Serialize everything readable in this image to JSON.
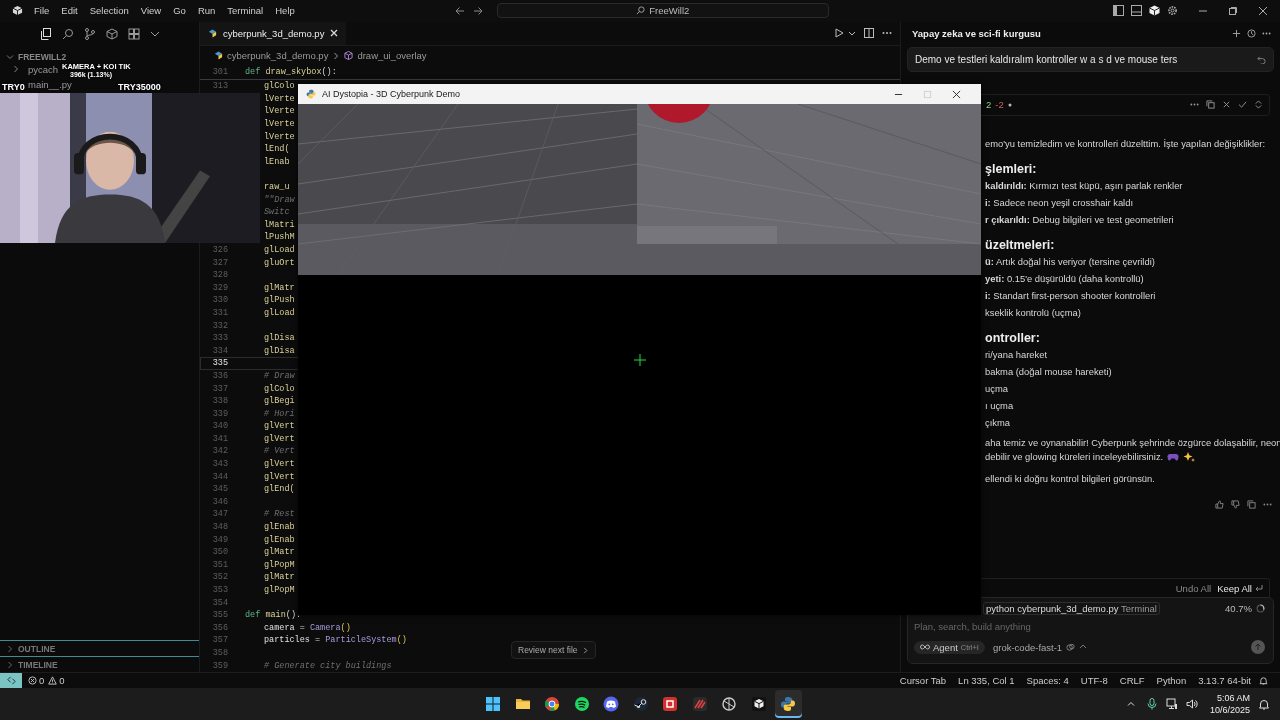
{
  "titlebar": {
    "menus": [
      "File",
      "Edit",
      "Selection",
      "View",
      "Go",
      "Run",
      "Terminal",
      "Help"
    ],
    "search": "FreeWill2"
  },
  "sidebar": {
    "section": "FREEWILL2",
    "items": [
      {
        "label": "pycach",
        "kind": "folder"
      },
      {
        "label": "main__.py",
        "kind": "file"
      }
    ],
    "panels": [
      "OUTLINE",
      "TIMELINE"
    ]
  },
  "editor": {
    "tab": "cyberpunk_3d_demo.py",
    "breadcrumbs": [
      "cyberpunk_3d_demo.py",
      "draw_ui_overlay"
    ],
    "sticky": {
      "number": "301",
      "parts": [
        {
          "text": "def ",
          "kind": "kw"
        },
        {
          "text": "draw_skybox",
          "kind": "fn"
        },
        {
          "text": "():",
          "kind": "p"
        }
      ]
    },
    "lines": [
      {
        "number": "313",
        "current": false,
        "kind": "body",
        "parts": [
          {
            "text": "glColo",
            "kind": "fn"
          }
        ]
      },
      {
        "current": false,
        "kind": "body",
        "parts": [
          {
            "text": "lVerte",
            "kind": "fn"
          }
        ]
      },
      {
        "current": false,
        "kind": "body",
        "parts": [
          {
            "text": "lVerte",
            "kind": "fn"
          }
        ]
      },
      {
        "current": false,
        "kind": "body",
        "parts": [
          {
            "text": "lVerte",
            "kind": "fn"
          }
        ]
      },
      {
        "current": false,
        "kind": "body",
        "parts": [
          {
            "text": "lVerte",
            "kind": "fn"
          }
        ]
      },
      {
        "current": false,
        "kind": "body",
        "parts": [
          {
            "text": "lEnd(",
            "kind": "fn"
          }
        ]
      },
      {
        "current": false,
        "kind": "body",
        "parts": [
          {
            "text": "lEnab",
            "kind": "fn"
          }
        ]
      },
      {
        "current": false,
        "kind": "blank"
      },
      {
        "current": false,
        "kind": "body",
        "parts": [
          {
            "text": "raw_u",
            "kind": "fn"
          }
        ]
      },
      {
        "current": false,
        "kind": "body",
        "parts": [
          {
            "text": "\"\"Draw",
            "kind": "doc"
          }
        ]
      },
      {
        "current": false,
        "kind": "body",
        "parts": [
          {
            "text": "Switc",
            "kind": "doc"
          }
        ]
      },
      {
        "current": false,
        "kind": "body",
        "parts": [
          {
            "text": "lMatri",
            "kind": "fn"
          }
        ]
      },
      {
        "current": false,
        "kind": "body",
        "parts": [
          {
            "text": "lPushM",
            "kind": "fn"
          }
        ]
      },
      {
        "number": "326",
        "current": false,
        "kind": "body",
        "parts": [
          {
            "text": "glLoad",
            "kind": "fn"
          }
        ]
      },
      {
        "number": "327",
        "current": false,
        "kind": "body",
        "parts": [
          {
            "text": "gluOrt",
            "kind": "fn"
          }
        ]
      },
      {
        "number": "328",
        "current": false,
        "kind": "blank"
      },
      {
        "number": "329",
        "current": false,
        "kind": "body",
        "parts": [
          {
            "text": "glMatr",
            "kind": "fn"
          }
        ]
      },
      {
        "number": "330",
        "current": false,
        "kind": "body",
        "parts": [
          {
            "text": "glPush",
            "kind": "fn"
          }
        ]
      },
      {
        "number": "331",
        "current": false,
        "kind": "body",
        "parts": [
          {
            "text": "glLoad",
            "kind": "fn"
          }
        ]
      },
      {
        "number": "332",
        "current": false,
        "kind": "blank"
      },
      {
        "number": "333",
        "current": false,
        "kind": "body",
        "parts": [
          {
            "text": "glDisa",
            "kind": "fn"
          }
        ]
      },
      {
        "number": "334",
        "current": false,
        "kind": "body",
        "parts": [
          {
            "text": "glDisa",
            "kind": "fn"
          }
        ]
      },
      {
        "number": "335",
        "current": true,
        "kind": "blank"
      },
      {
        "number": "336",
        "current": false,
        "kind": "body",
        "parts": [
          {
            "text": "# Draw",
            "kind": "cm"
          }
        ]
      },
      {
        "number": "337",
        "current": false,
        "kind": "body",
        "parts": [
          {
            "text": "glColo",
            "kind": "fn"
          }
        ]
      },
      {
        "number": "338",
        "current": false,
        "kind": "body",
        "parts": [
          {
            "text": "glBegi",
            "kind": "fn"
          }
        ]
      },
      {
        "number": "339",
        "current": false,
        "kind": "body",
        "parts": [
          {
            "text": "# Hori",
            "kind": "cm"
          }
        ]
      },
      {
        "number": "340",
        "current": false,
        "kind": "body",
        "parts": [
          {
            "text": "glVert",
            "kind": "fn"
          }
        ]
      },
      {
        "number": "341",
        "current": false,
        "kind": "body",
        "parts": [
          {
            "text": "glVert",
            "kind": "fn"
          }
        ]
      },
      {
        "number": "342",
        "current": false,
        "kind": "body",
        "parts": [
          {
            "text": "# Vert",
            "kind": "cm"
          }
        ]
      },
      {
        "number": "343",
        "current": false,
        "kind": "body",
        "parts": [
          {
            "text": "glVert",
            "kind": "fn"
          }
        ]
      },
      {
        "number": "344",
        "current": false,
        "kind": "body",
        "parts": [
          {
            "text": "glVert",
            "kind": "fn"
          }
        ]
      },
      {
        "number": "345",
        "current": false,
        "kind": "body",
        "parts": [
          {
            "text": "glEnd(",
            "kind": "fn"
          }
        ]
      },
      {
        "number": "346",
        "current": false,
        "kind": "blank"
      },
      {
        "number": "347",
        "current": false,
        "kind": "body",
        "parts": [
          {
            "text": "# Rest",
            "kind": "cm"
          }
        ]
      },
      {
        "number": "348",
        "current": false,
        "kind": "body",
        "parts": [
          {
            "text": "glEnab",
            "kind": "fn"
          }
        ]
      },
      {
        "number": "349",
        "current": false,
        "kind": "body",
        "parts": [
          {
            "text": "glEnab",
            "kind": "fn"
          }
        ]
      },
      {
        "number": "350",
        "current": false,
        "kind": "body",
        "parts": [
          {
            "text": "glMatr",
            "kind": "fn"
          }
        ]
      },
      {
        "number": "351",
        "current": false,
        "kind": "body",
        "parts": [
          {
            "text": "glPopM",
            "kind": "fn"
          }
        ]
      },
      {
        "number": "352",
        "current": false,
        "kind": "body",
        "parts": [
          {
            "text": "glMatr",
            "kind": "fn"
          }
        ]
      },
      {
        "number": "353",
        "current": false,
        "kind": "body",
        "parts": [
          {
            "text": "glPopM",
            "kind": "fn"
          }
        ]
      },
      {
        "number": "354",
        "current": false,
        "kind": "blank"
      },
      {
        "number": "355",
        "current": false,
        "kind": "def",
        "parts": [
          {
            "text": "def ",
            "kind": "kw"
          },
          {
            "text": "main",
            "kind": "fn"
          },
          {
            "text": "():",
            "kind": "p"
          }
        ]
      },
      {
        "number": "356",
        "current": false,
        "kind": "body",
        "parts": [
          {
            "text": "camera",
            "kind": "var"
          },
          {
            "text": " = ",
            "kind": "p"
          },
          {
            "text": "Camera",
            "kind": "cls"
          },
          {
            "text": "()",
            "kind": "br"
          }
        ]
      },
      {
        "number": "357",
        "current": false,
        "kind": "body",
        "parts": [
          {
            "text": "particles",
            "kind": "var"
          },
          {
            "text": " = ",
            "kind": "p"
          },
          {
            "text": "ParticleSystem",
            "kind": "cls"
          },
          {
            "text": "()",
            "kind": "br"
          }
        ]
      },
      {
        "number": "358",
        "current": false,
        "kind": "blank"
      },
      {
        "number": "359",
        "current": false,
        "kind": "body",
        "parts": [
          {
            "text": "# Generate city buildings",
            "kind": "cm"
          }
        ]
      }
    ],
    "review_button": "Review next file"
  },
  "game_window": {
    "title": "AI Dystopia - 3D Cyberpunk Demo",
    "maximize_disabled": true
  },
  "stream_overlay": {
    "title": "KAMERA + KOI TIK",
    "stat": "396k (1.13%)",
    "left": "TRY0",
    "right": "TRY35000"
  },
  "chat": {
    "title": "Yapay zeka ve sci-fi kurgusu",
    "user_message": "Demo ve testleri kaldıralım kontroller w a s d ve mouse ters",
    "diff": {
      "added": "2",
      "removed": "-2"
    },
    "blocks": [
      {
        "kind": "text",
        "text": "emo'yu temizledim ve kontrolleri düzelttim. İşte yapılan değişiklikler:"
      },
      {
        "kind": "heading",
        "text": "şlemleri:"
      },
      {
        "kind": "item",
        "text": "**kaldırıldı:** Kırmızı test küpü, aşırı parlak renkler"
      },
      {
        "kind": "item",
        "text": "**i:** Sadece neon yeşil crosshair kaldı"
      },
      {
        "kind": "item",
        "text": "**r çıkarıldı:** Debug bilgileri ve test geometrileri"
      },
      {
        "kind": "heading",
        "text": "üzeltmeleri:"
      },
      {
        "kind": "item",
        "text": "**ü:** Artık doğal his veriyor (tersine çevrildi)"
      },
      {
        "kind": "item",
        "text": "**yeti:** 0.15'e düşürüldü (daha kontrollü)"
      },
      {
        "kind": "item",
        "text": "**i:** Standart first-person shooter kontrolleri"
      },
      {
        "kind": "item",
        "text": "kseklik kontrolü (uçma)"
      },
      {
        "kind": "heading",
        "text": "ontroller:"
      },
      {
        "kind": "item",
        "text": "ri/yana hareket"
      },
      {
        "kind": "item",
        "text": "bakma (doğal mouse hareketi)"
      },
      {
        "kind": "item",
        "text": "uçma"
      },
      {
        "kind": "item",
        "text": "ı uçma"
      },
      {
        "kind": "item",
        "text": "çıkma"
      },
      {
        "kind": "para",
        "text": "aha temiz ve oynanabilir! Cyberpunk şehrinde özgürce dolaşabilir, neon"
      },
      {
        "kind": "emoji-line",
        "text": "debilir ve glowing küreleri inceleyebilirsiniz."
      },
      {
        "kind": "para",
        "text": "ellendi ki doğru kontrol bilgileri görünsün."
      }
    ],
    "undo": "Undo All",
    "keep": "Keep All",
    "terminal": {
      "command": "python cyberpunk_3d_demo.py",
      "label": "Terminal"
    },
    "context": "40.7%",
    "placeholder": "Plan, search, build anything",
    "mode": "Agent",
    "shortcut": "Ctrl+I",
    "model": "grok-code-fast-1"
  },
  "status_bar": {
    "errors": "0",
    "warnings": "0",
    "items": [
      "Cursor Tab",
      "Ln 335, Col 1",
      "Spaces: 4",
      "UTF-8",
      "CRLF",
      "Python",
      "3.13.7 64-bit"
    ]
  },
  "taskbar": {
    "apps": [
      {
        "kind": "start",
        "active": false
      },
      {
        "kind": "folder",
        "active": false
      },
      {
        "kind": "browser",
        "active": false
      },
      {
        "kind": "audio",
        "active": false
      },
      {
        "kind": "chat",
        "active": false
      },
      {
        "kind": "store",
        "active": false
      },
      {
        "kind": "red",
        "active": false
      },
      {
        "kind": "stripes",
        "active": false
      },
      {
        "kind": "ring",
        "active": false
      },
      {
        "kind": "cube",
        "active": false
      },
      {
        "kind": "python",
        "active": true
      }
    ],
    "time": "5:06 AM",
    "date": "10/6/2025"
  }
}
